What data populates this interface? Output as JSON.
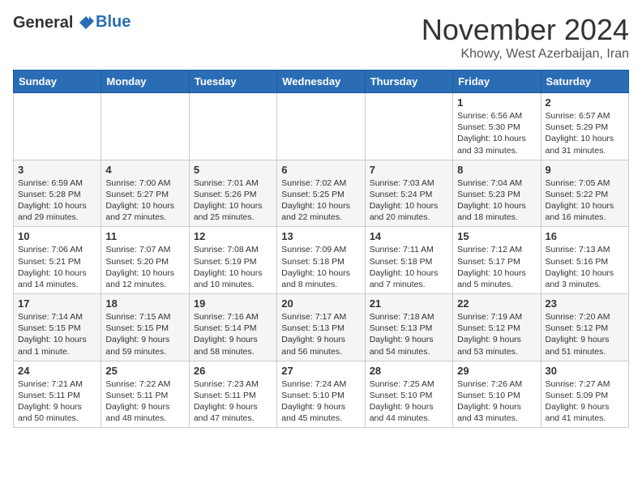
{
  "header": {
    "logo_line1": "General",
    "logo_line2": "Blue",
    "month_title": "November 2024",
    "location": "Khowy, West Azerbaijan, Iran"
  },
  "weekdays": [
    "Sunday",
    "Monday",
    "Tuesday",
    "Wednesday",
    "Thursday",
    "Friday",
    "Saturday"
  ],
  "weeks": [
    [
      {
        "day": "",
        "info": ""
      },
      {
        "day": "",
        "info": ""
      },
      {
        "day": "",
        "info": ""
      },
      {
        "day": "",
        "info": ""
      },
      {
        "day": "",
        "info": ""
      },
      {
        "day": "1",
        "info": "Sunrise: 6:56 AM\nSunset: 5:30 PM\nDaylight: 10 hours and 33 minutes."
      },
      {
        "day": "2",
        "info": "Sunrise: 6:57 AM\nSunset: 5:29 PM\nDaylight: 10 hours and 31 minutes."
      }
    ],
    [
      {
        "day": "3",
        "info": "Sunrise: 6:59 AM\nSunset: 5:28 PM\nDaylight: 10 hours and 29 minutes."
      },
      {
        "day": "4",
        "info": "Sunrise: 7:00 AM\nSunset: 5:27 PM\nDaylight: 10 hours and 27 minutes."
      },
      {
        "day": "5",
        "info": "Sunrise: 7:01 AM\nSunset: 5:26 PM\nDaylight: 10 hours and 25 minutes."
      },
      {
        "day": "6",
        "info": "Sunrise: 7:02 AM\nSunset: 5:25 PM\nDaylight: 10 hours and 22 minutes."
      },
      {
        "day": "7",
        "info": "Sunrise: 7:03 AM\nSunset: 5:24 PM\nDaylight: 10 hours and 20 minutes."
      },
      {
        "day": "8",
        "info": "Sunrise: 7:04 AM\nSunset: 5:23 PM\nDaylight: 10 hours and 18 minutes."
      },
      {
        "day": "9",
        "info": "Sunrise: 7:05 AM\nSunset: 5:22 PM\nDaylight: 10 hours and 16 minutes."
      }
    ],
    [
      {
        "day": "10",
        "info": "Sunrise: 7:06 AM\nSunset: 5:21 PM\nDaylight: 10 hours and 14 minutes."
      },
      {
        "day": "11",
        "info": "Sunrise: 7:07 AM\nSunset: 5:20 PM\nDaylight: 10 hours and 12 minutes."
      },
      {
        "day": "12",
        "info": "Sunrise: 7:08 AM\nSunset: 5:19 PM\nDaylight: 10 hours and 10 minutes."
      },
      {
        "day": "13",
        "info": "Sunrise: 7:09 AM\nSunset: 5:18 PM\nDaylight: 10 hours and 8 minutes."
      },
      {
        "day": "14",
        "info": "Sunrise: 7:11 AM\nSunset: 5:18 PM\nDaylight: 10 hours and 7 minutes."
      },
      {
        "day": "15",
        "info": "Sunrise: 7:12 AM\nSunset: 5:17 PM\nDaylight: 10 hours and 5 minutes."
      },
      {
        "day": "16",
        "info": "Sunrise: 7:13 AM\nSunset: 5:16 PM\nDaylight: 10 hours and 3 minutes."
      }
    ],
    [
      {
        "day": "17",
        "info": "Sunrise: 7:14 AM\nSunset: 5:15 PM\nDaylight: 10 hours and 1 minute."
      },
      {
        "day": "18",
        "info": "Sunrise: 7:15 AM\nSunset: 5:15 PM\nDaylight: 9 hours and 59 minutes."
      },
      {
        "day": "19",
        "info": "Sunrise: 7:16 AM\nSunset: 5:14 PM\nDaylight: 9 hours and 58 minutes."
      },
      {
        "day": "20",
        "info": "Sunrise: 7:17 AM\nSunset: 5:13 PM\nDaylight: 9 hours and 56 minutes."
      },
      {
        "day": "21",
        "info": "Sunrise: 7:18 AM\nSunset: 5:13 PM\nDaylight: 9 hours and 54 minutes."
      },
      {
        "day": "22",
        "info": "Sunrise: 7:19 AM\nSunset: 5:12 PM\nDaylight: 9 hours and 53 minutes."
      },
      {
        "day": "23",
        "info": "Sunrise: 7:20 AM\nSunset: 5:12 PM\nDaylight: 9 hours and 51 minutes."
      }
    ],
    [
      {
        "day": "24",
        "info": "Sunrise: 7:21 AM\nSunset: 5:11 PM\nDaylight: 9 hours and 50 minutes."
      },
      {
        "day": "25",
        "info": "Sunrise: 7:22 AM\nSunset: 5:11 PM\nDaylight: 9 hours and 48 minutes."
      },
      {
        "day": "26",
        "info": "Sunrise: 7:23 AM\nSunset: 5:11 PM\nDaylight: 9 hours and 47 minutes."
      },
      {
        "day": "27",
        "info": "Sunrise: 7:24 AM\nSunset: 5:10 PM\nDaylight: 9 hours and 45 minutes."
      },
      {
        "day": "28",
        "info": "Sunrise: 7:25 AM\nSunset: 5:10 PM\nDaylight: 9 hours and 44 minutes."
      },
      {
        "day": "29",
        "info": "Sunrise: 7:26 AM\nSunset: 5:10 PM\nDaylight: 9 hours and 43 minutes."
      },
      {
        "day": "30",
        "info": "Sunrise: 7:27 AM\nSunset: 5:09 PM\nDaylight: 9 hours and 41 minutes."
      }
    ]
  ]
}
